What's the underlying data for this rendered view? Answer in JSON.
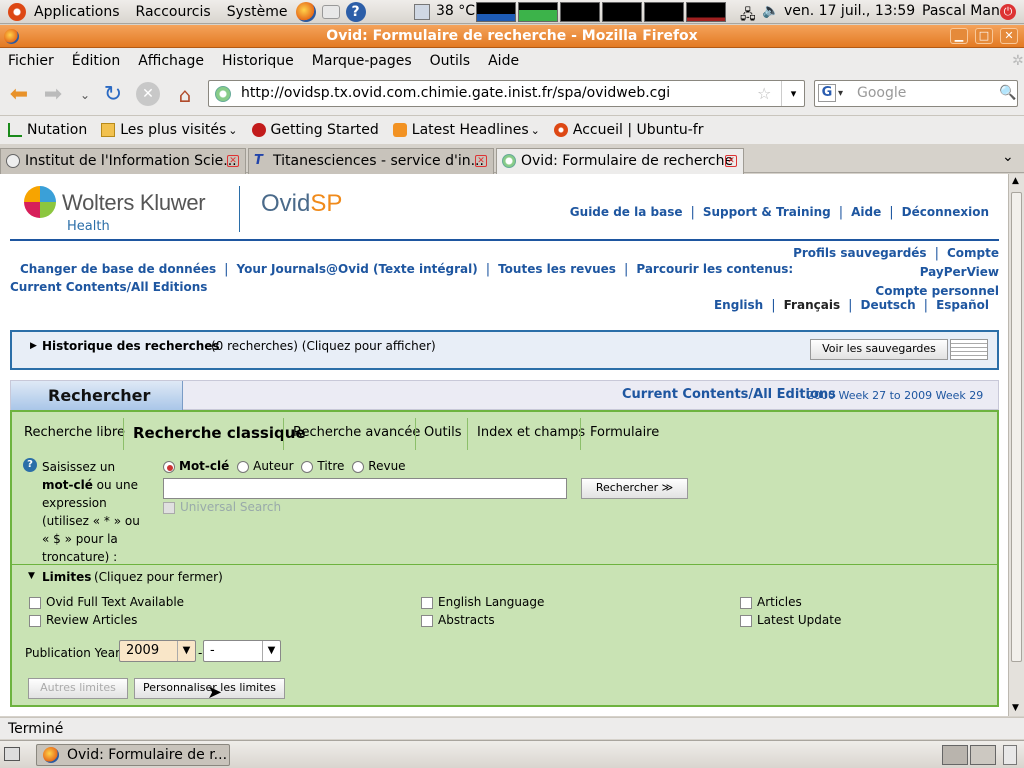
{
  "panel": {
    "menus": [
      "Applications",
      "Raccourcis",
      "Système"
    ],
    "temperature": "38 °C",
    "datetime": "ven. 17 juil., 13:59",
    "user": "Pascal Man"
  },
  "window": {
    "title": "Ovid: Formulaire de recherche - Mozilla Firefox"
  },
  "menubar": [
    "Fichier",
    "Édition",
    "Affichage",
    "Historique",
    "Marque-pages",
    "Outils",
    "Aide"
  ],
  "nav": {
    "url": "http://ovidsp.tx.ovid.com.chimie.gate.inist.fr/spa/ovidweb.cgi",
    "search_placeholder": "Google"
  },
  "bookmarks": [
    {
      "label": "Nutation",
      "icon": "chart-icon"
    },
    {
      "label": "Les plus visités",
      "icon": "folder-icon"
    },
    {
      "label": "Getting Started",
      "icon": "firefox-icon"
    },
    {
      "label": "Latest Headlines",
      "icon": "rss-icon"
    },
    {
      "label": "Accueil | Ubuntu-fr",
      "icon": "ubuntu-icon"
    }
  ],
  "tabs": [
    {
      "label": "Institut de l'Information Scie...",
      "active": false
    },
    {
      "label": "Titanesciences - service d'in...",
      "active": false
    },
    {
      "label": "Ovid: Formulaire de recherche",
      "active": true
    }
  ],
  "page": {
    "logo": {
      "brand": "Wolters Kluwer",
      "sub": "Health",
      "product_a": "Ovid",
      "product_b": "SP"
    },
    "toplinks": [
      "Guide de la base",
      "Support & Training",
      "Aide",
      "Déconnexion"
    ],
    "right_links": [
      "Profils sauvegardés",
      "Compte",
      "PayPerView",
      "Compte personnel"
    ],
    "navlinks": [
      "Changer de base de données",
      "Your Journals@Ovid (Texte intégral)",
      "Toutes les revues",
      "Parcourir les contenus:"
    ],
    "navlink2": "Current Contents/All Editions",
    "languages": [
      "English",
      "Français",
      "Deutsch",
      "Español"
    ],
    "history": {
      "title": "Historique des recherches",
      "detail": "(0 recherches) (Cliquez pour afficher)",
      "button": "Voir les sauvegardes"
    },
    "search": {
      "heading": "Rechercher",
      "database": "Current Contents/All Editions",
      "range": "2000 Week 27 to 2009 Week 29",
      "tabs": [
        "Recherche libre",
        "Recherche classique",
        "Recherche avancée",
        "Outils",
        "Index et champs",
        "Formulaire"
      ],
      "active_tab": 1,
      "help_lines": [
        "Saisissez un",
        "mot-clé",
        " ou une",
        "expression",
        "(utilisez « * » ou",
        "« $ » pour la",
        "troncature) :"
      ],
      "radios": [
        "Mot-clé",
        "Auteur",
        "Titre",
        "Revue"
      ],
      "query": "",
      "search_button": "Rechercher ≫",
      "universal": "Universal Search"
    },
    "limits": {
      "title": "Limites",
      "detail": "(Cliquez pour fermer)",
      "col1": [
        "Ovid Full Text Available",
        "Review Articles"
      ],
      "col2": [
        "English Language",
        "Abstracts"
      ],
      "col3": [
        "Articles",
        "Latest Update"
      ],
      "pubyear_label": "Publication Year",
      "pubyear_from": "2009",
      "pubyear_sep": "-",
      "pubyear_to": "-",
      "btn_more": "Autres limites",
      "btn_custom": "Personnaliser les limites"
    }
  },
  "status": "Terminé",
  "taskbar": {
    "item": "Ovid: Formulaire de r..."
  }
}
